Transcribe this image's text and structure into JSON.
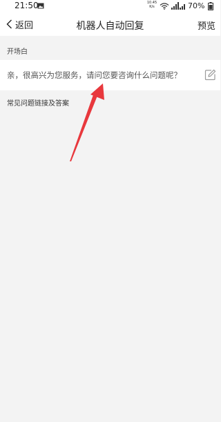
{
  "status_bar": {
    "time": "21:50",
    "speed_value": "10.45",
    "speed_unit": "K/s",
    "battery": "70%",
    "icons": [
      "image-icon",
      "wifi-icon",
      "signal-icon",
      "battery-icon"
    ]
  },
  "nav": {
    "back_label": "返回",
    "title": "机器人自动回复",
    "preview_label": "预览"
  },
  "opening": {
    "section_label": "开场白",
    "greeting": "亲，很高兴为您服务，请问您要咨询什么问题呢？"
  },
  "faq": {
    "section_label": "常见问题链接及答案"
  },
  "colors": {
    "page_background": "#f3f3f3",
    "bar_background": "#ffffff",
    "annotation_arrow": "#e8383d"
  }
}
